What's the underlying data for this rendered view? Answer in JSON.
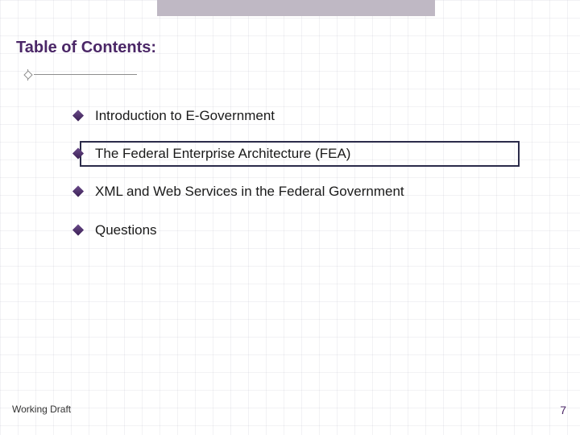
{
  "header": {
    "title": "Table of Contents:"
  },
  "toc": {
    "items": [
      {
        "label": "Introduction to E-Government",
        "highlight": false
      },
      {
        "label": "The Federal Enterprise Architecture (FEA)",
        "highlight": true
      },
      {
        "label": "XML and Web Services in the Federal Government",
        "highlight": false
      },
      {
        "label": "Questions",
        "highlight": false
      }
    ]
  },
  "footer": {
    "status": "Working Draft",
    "page_number": "7"
  }
}
